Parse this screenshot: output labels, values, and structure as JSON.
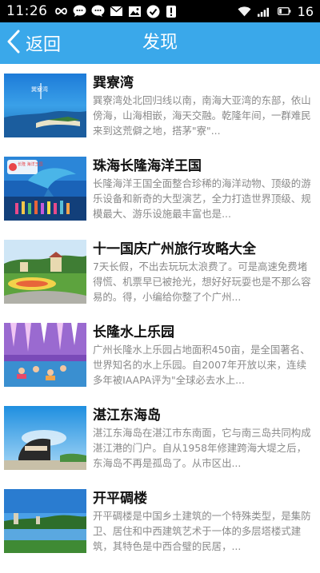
{
  "status_bar": {
    "time": "11:26",
    "battery": "16"
  },
  "nav": {
    "back_label": "返回",
    "title": "发现"
  },
  "items": [
    {
      "title": "巽寮湾",
      "desc": "巽寮湾处北回归线以南，南海大亚湾的东部，依山傍海，山海相嵌，海天交融。乾隆年间，一群难民来到这荒僻之地，搭茅\"寮\"...",
      "thumb_caption": "巽寮湾"
    },
    {
      "title": "珠海长隆海洋王国",
      "desc": "长隆海洋王国全面整合珍稀的海洋动物、顶级的游乐设备和新奇的大型演艺，全力打造世界顶级、规模最大、游乐设施最丰富也是...",
      "thumb_caption": "长隆 海洋王国"
    },
    {
      "title": "十一国庆广州旅行攻略大全",
      "desc": "7天长假，不出去玩玩太浪费了。可是高速免费堵得慌、机票早已被抢光，想好好玩耍也是不那么容易的。得，小编给你整了个广州...",
      "thumb_caption": ""
    },
    {
      "title": "长隆水上乐园",
      "desc": "广州长隆水上乐园占地面积450亩，是全国著名、世界知名的水上乐园。自2007年开放以来，连续多年被IAAPA评为\"全球必去水上...",
      "thumb_caption": ""
    },
    {
      "title": "湛江东海岛",
      "desc": "湛江东海岛在湛江市东南面，它与南三岛共同构成湛江港的门户。自从1958年修建跨海大堤之后，东海岛不再是孤岛了。从市区出...",
      "thumb_caption": ""
    },
    {
      "title": "开平碉楼",
      "desc": "开平碉楼是中国乡土建筑的一个特殊类型，是集防卫、居住和中西建筑艺术于一体的多层塔楼式建筑，其特色是中西合璧的民居，...",
      "thumb_caption": ""
    }
  ]
}
